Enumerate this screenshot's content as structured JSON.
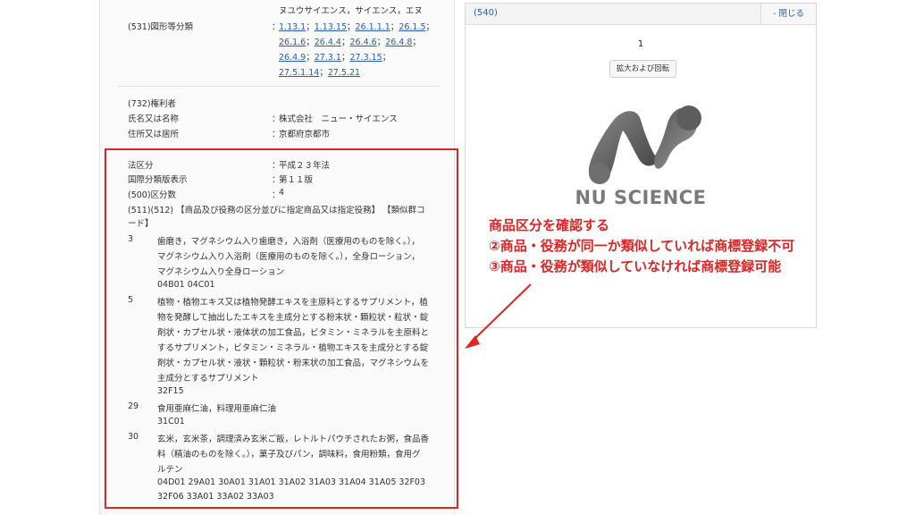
{
  "top_partial": {
    "text": "ヌユウサイエンス，サイエンス，エヌ"
  },
  "figure_class": {
    "label": "(531)図形等分類",
    "colon": "：",
    "codes_line1": [
      "1.13.1",
      "1.13.15",
      "26.1.1.1",
      "26.1.5"
    ],
    "codes_line2": [
      "26.1.6",
      "26.4.4",
      "26.4.6",
      "26.4.8"
    ],
    "codes_line3": [
      "26.4.9",
      "27.3.1",
      "27.3.15"
    ],
    "codes_line4": [
      "27.5.1.14",
      "27.5.21"
    ],
    "separator": "；"
  },
  "owner": {
    "section_label": "(732)権利者",
    "name_label": "氏名又は名称",
    "name_value": "株式会社　ニュー・サイエンス",
    "address_label": "住所又は居所",
    "address_value": "京都府京都市"
  },
  "law": {
    "law_label": "法区分",
    "law_value": "平成２３年法",
    "intl_label": "国際分類版表示",
    "intl_value": "第１１版",
    "class_count_label": "(500)区分数",
    "class_count_value": "4",
    "goods_header_1": "(511)(512) 【商品及び役務の区分並びに指定商品又は指定役務】 【類似群コ",
    "goods_header_2": "ード】"
  },
  "goods": [
    {
      "code": "3",
      "lines": [
        "歯磨き，マグネシウム入り歯磨き，入浴剤（医療用のものを除く。），",
        "マグネシウム入り入浴剤（医療用のものを除く。），全身ローション，",
        "マグネシウム入り全身ローション"
      ],
      "groups": "04B01 04C01"
    },
    {
      "code": "5",
      "lines": [
        "植物・植物エキス又は植物発酵エキスを主原料とするサプリメント，植",
        "物を発酵して抽出したエキスを主成分とする粉末状・顆粒状・粒状・錠",
        "剤状・カプセル状・液体状の加工食品，ビタミン・ミネラルを主原料と",
        "するサプリメント，ビタミン・ミネラル・植物エキスを主成分とする錠",
        "剤状・カプセル状・液状・顆粒状・粉末状の加工食品，マグネシウムを",
        "主成分とするサプリメント"
      ],
      "groups": "32F15"
    },
    {
      "code": "29",
      "lines": [
        "食用亜麻仁油，料理用亜麻仁油"
      ],
      "groups": "31C01"
    },
    {
      "code": "30",
      "lines": [
        "玄米，玄米茶，調理済み玄米ご飯，レトルトパウチされたお粥，食品香",
        "料（精油のものを除く。），菓子及びパン，調味料，食用粉類，食用グ",
        "ルテン"
      ],
      "groups": "04D01 29A01 30A01 31A01 31A02 31A03 31A04 31A05 32F03",
      "groups2": "32F06 33A01 33A02 33A03"
    }
  ],
  "viewer": {
    "number_label": "(540)",
    "close_label": "- 閉じる",
    "page_index": "1",
    "zoom_label": "拡大および回転",
    "logo_text": "NU SCIENCE"
  },
  "annotation": {
    "line1": "商品区分を確認する",
    "line2": "②商品・役務が同一か類似していれば商標登録不可",
    "line3": "③商品・役務が類似していなければ商標登録可能",
    "color": "#e02323"
  }
}
